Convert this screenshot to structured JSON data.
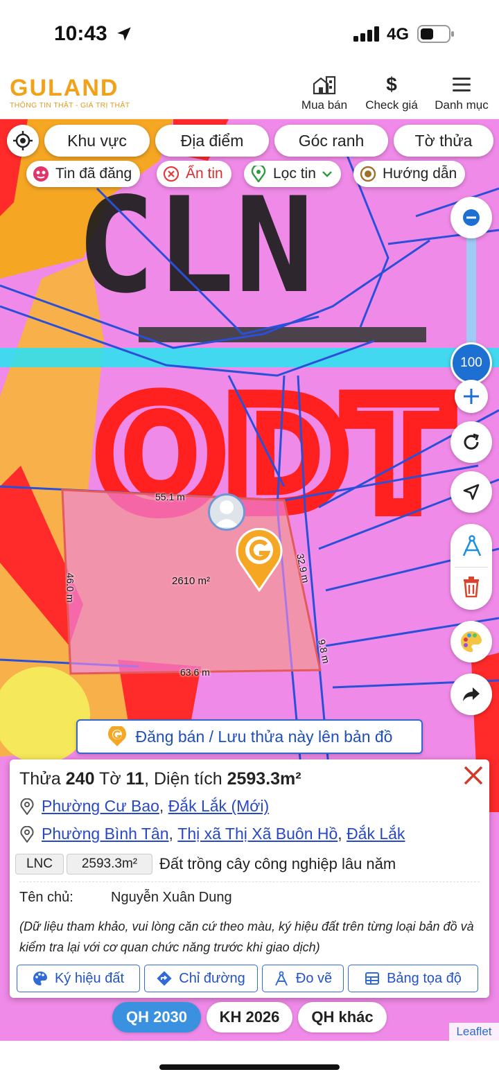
{
  "status_bar": {
    "time": "10:43",
    "network": "4G"
  },
  "header": {
    "logo": "GULAND",
    "tagline": "THÔNG TIN THẬT - GIÁ TRỊ THẬT",
    "nav": [
      {
        "label": "Mua bán",
        "icon": "buildings-icon"
      },
      {
        "label": "Check giá",
        "icon": "dollar-icon"
      },
      {
        "label": "Danh mục",
        "icon": "menu-icon"
      }
    ]
  },
  "filters": {
    "chips": [
      "Khu vực",
      "Địa điểm",
      "Góc ranh",
      "Tờ thửa"
    ],
    "pills": [
      "Tin đã đăng",
      "Ẩn tin",
      "Lọc tin",
      "Hướng dẫn"
    ]
  },
  "map": {
    "zoom_level": "100",
    "zone_labels": [
      "CLN",
      "ODT"
    ],
    "parcel": {
      "top_edge": "55.1 m",
      "left_edge": "46.0 m",
      "right_edge_upper": "32.9 m",
      "right_edge_lower": "9.8 m",
      "bottom_edge": "63.6 m",
      "area": "2610 m²"
    },
    "post_button": "Đăng bán / Lưu thửa này lên bản đồ",
    "attribution": "Leaflet"
  },
  "panel": {
    "title_prefix": "Thửa",
    "parcel_no": "240",
    "sheet_prefix": "Tờ",
    "sheet_no": "11",
    "area_prefix": "Diện tích",
    "area_value": "2593.3m²",
    "address_new": {
      "ward": "Phường Cư Bao",
      "province": "Đắk Lắk (Mới)"
    },
    "address_old": {
      "ward": "Phường Bình Tân",
      "town": "Thị xã Thị Xã Buôn Hồ",
      "province": "Đắk Lắk"
    },
    "land_code": "LNC",
    "land_area": "2593.3m²",
    "land_desc": "Đất trồng cây công nghiệp lâu năm",
    "owner_label": "Tên chủ:",
    "owner_name": "Nguyễn Xuân Dung",
    "note": "(Dữ liệu tham khảo, vui lòng căn cứ theo màu, ký hiệu đất trên từng loại bản đồ và kiểm tra lại với cơ quan chức năng trước khi giao dịch)",
    "actions": [
      "Ký hiệu đất",
      "Chỉ đường",
      "Đo vẽ",
      "Bảng tọa độ"
    ]
  },
  "plans": [
    "QH 2030",
    "KH 2026",
    "QH khác"
  ],
  "colors": {
    "brand": "#f2a21a",
    "link": "#2748c7",
    "active_plan": "#3a91e0",
    "land_pink": "#f08ae8",
    "land_orange": "#f5a623",
    "road_red": "#ff2222",
    "cyan_strip": "#2fe0f0"
  }
}
